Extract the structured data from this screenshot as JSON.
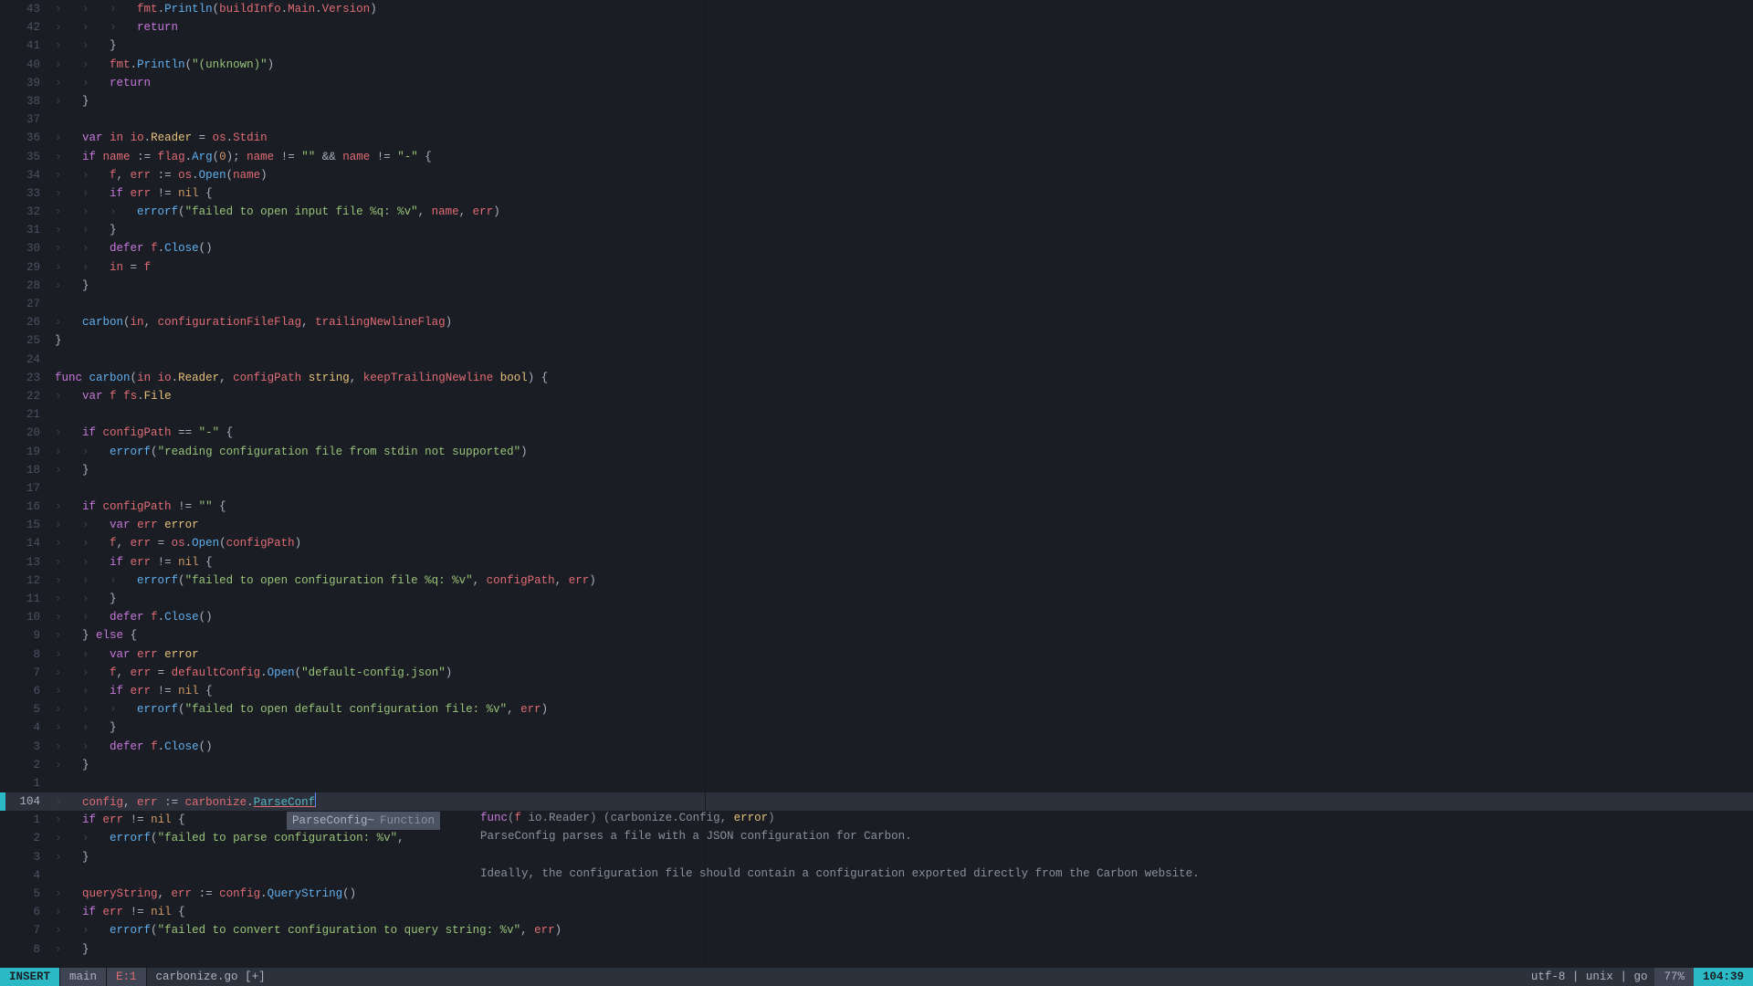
{
  "statusline": {
    "mode": "INSERT",
    "branch": "main",
    "errors": "E:1",
    "file": "carbonize.go [+]",
    "encoding": "utf-8",
    "format": "unix",
    "filetype": "go",
    "percent": "77%",
    "position": "104:39"
  },
  "completion": {
    "match": "ParseConfig~",
    "kind": "Function",
    "signature": "func(f io.Reader) (carbonize.Config, error)",
    "doc": "ParseConfig parses a file with a JSON configuration for Carbon.",
    "doc2": "Ideally, the configuration file should contain a configuration exported directly from the Carbon website."
  },
  "gutter_current": "104",
  "tabchar": "›   ",
  "code_lines": [
    {
      "rel": "43",
      "tabs": 3,
      "tokens": [
        [
          "ident",
          "fmt"
        ],
        [
          "punct",
          "."
        ],
        [
          "fnname",
          "Println"
        ],
        [
          "punct",
          "("
        ],
        [
          "ident",
          "buildInfo"
        ],
        [
          "punct",
          "."
        ],
        [
          "ident",
          "Main"
        ],
        [
          "punct",
          "."
        ],
        [
          "ident",
          "Version"
        ],
        [
          "punct",
          ")"
        ]
      ]
    },
    {
      "rel": "42",
      "tabs": 3,
      "tokens": [
        [
          "kw",
          "return"
        ]
      ]
    },
    {
      "rel": "41",
      "tabs": 2,
      "tokens": [
        [
          "punct",
          "}"
        ]
      ]
    },
    {
      "rel": "40",
      "tabs": 2,
      "tokens": [
        [
          "ident",
          "fmt"
        ],
        [
          "punct",
          "."
        ],
        [
          "fnname",
          "Println"
        ],
        [
          "punct",
          "("
        ],
        [
          "str",
          "\"(unknown)\""
        ],
        [
          "punct",
          ")"
        ]
      ]
    },
    {
      "rel": "39",
      "tabs": 2,
      "tokens": [
        [
          "kw",
          "return"
        ]
      ]
    },
    {
      "rel": "38",
      "tabs": 1,
      "tokens": [
        [
          "punct",
          "}"
        ]
      ]
    },
    {
      "rel": "37",
      "tabs": 0,
      "tokens": []
    },
    {
      "rel": "36",
      "tabs": 1,
      "tokens": [
        [
          "kw",
          "var"
        ],
        [
          "op",
          " "
        ],
        [
          "ident",
          "in"
        ],
        [
          "op",
          " "
        ],
        [
          "ident",
          "io"
        ],
        [
          "punct",
          "."
        ],
        [
          "type",
          "Reader"
        ],
        [
          "op",
          " = "
        ],
        [
          "ident",
          "os"
        ],
        [
          "punct",
          "."
        ],
        [
          "ident",
          "Stdin"
        ]
      ]
    },
    {
      "rel": "35",
      "tabs": 1,
      "tokens": [
        [
          "kw",
          "if"
        ],
        [
          "op",
          " "
        ],
        [
          "ident",
          "name"
        ],
        [
          "op",
          " := "
        ],
        [
          "ident",
          "flag"
        ],
        [
          "punct",
          "."
        ],
        [
          "fnname",
          "Arg"
        ],
        [
          "punct",
          "("
        ],
        [
          "num",
          "0"
        ],
        [
          "punct",
          "); "
        ],
        [
          "ident",
          "name"
        ],
        [
          "op",
          " != "
        ],
        [
          "str",
          "\"\""
        ],
        [
          "op",
          " && "
        ],
        [
          "ident",
          "name"
        ],
        [
          "op",
          " != "
        ],
        [
          "str",
          "\"-\""
        ],
        [
          "op",
          " "
        ],
        [
          "punct",
          "{"
        ]
      ]
    },
    {
      "rel": "34",
      "tabs": 2,
      "tokens": [
        [
          "ident",
          "f"
        ],
        [
          "punct",
          ", "
        ],
        [
          "ident",
          "err"
        ],
        [
          "op",
          " := "
        ],
        [
          "ident",
          "os"
        ],
        [
          "punct",
          "."
        ],
        [
          "fnname",
          "Open"
        ],
        [
          "punct",
          "("
        ],
        [
          "ident",
          "name"
        ],
        [
          "punct",
          ")"
        ]
      ]
    },
    {
      "rel": "33",
      "tabs": 2,
      "tokens": [
        [
          "kw",
          "if"
        ],
        [
          "op",
          " "
        ],
        [
          "ident",
          "err"
        ],
        [
          "op",
          " != "
        ],
        [
          "builtin",
          "nil"
        ],
        [
          "op",
          " "
        ],
        [
          "punct",
          "{"
        ]
      ]
    },
    {
      "rel": "32",
      "tabs": 3,
      "tokens": [
        [
          "fnname",
          "errorf"
        ],
        [
          "punct",
          "("
        ],
        [
          "str",
          "\"failed to open input file %q: %v\""
        ],
        [
          "punct",
          ", "
        ],
        [
          "ident",
          "name"
        ],
        [
          "punct",
          ", "
        ],
        [
          "ident",
          "err"
        ],
        [
          "punct",
          ")"
        ]
      ]
    },
    {
      "rel": "31",
      "tabs": 2,
      "tokens": [
        [
          "punct",
          "}"
        ]
      ]
    },
    {
      "rel": "30",
      "tabs": 2,
      "tokens": [
        [
          "kw",
          "defer"
        ],
        [
          "op",
          " "
        ],
        [
          "ident",
          "f"
        ],
        [
          "punct",
          "."
        ],
        [
          "fnname",
          "Close"
        ],
        [
          "punct",
          "()"
        ]
      ]
    },
    {
      "rel": "29",
      "tabs": 2,
      "tokens": [
        [
          "ident",
          "in"
        ],
        [
          "op",
          " = "
        ],
        [
          "ident",
          "f"
        ]
      ]
    },
    {
      "rel": "28",
      "tabs": 1,
      "tokens": [
        [
          "punct",
          "}"
        ]
      ]
    },
    {
      "rel": "27",
      "tabs": 0,
      "tokens": []
    },
    {
      "rel": "26",
      "tabs": 1,
      "tokens": [
        [
          "fnname",
          "carbon"
        ],
        [
          "punct",
          "("
        ],
        [
          "ident",
          "in"
        ],
        [
          "punct",
          ", "
        ],
        [
          "ident",
          "configurationFileFlag"
        ],
        [
          "punct",
          ", "
        ],
        [
          "ident",
          "trailingNewlineFlag"
        ],
        [
          "punct",
          ")"
        ]
      ]
    },
    {
      "rel": "25",
      "tabs": 0,
      "tokens": [
        [
          "punct",
          "}"
        ]
      ]
    },
    {
      "rel": "24",
      "tabs": 0,
      "tokens": []
    },
    {
      "rel": "23",
      "tabs": 0,
      "tokens": [
        [
          "kw",
          "func"
        ],
        [
          "op",
          " "
        ],
        [
          "fnname",
          "carbon"
        ],
        [
          "punct",
          "("
        ],
        [
          "ident",
          "in"
        ],
        [
          "op",
          " "
        ],
        [
          "ident",
          "io"
        ],
        [
          "punct",
          "."
        ],
        [
          "type",
          "Reader"
        ],
        [
          "punct",
          ", "
        ],
        [
          "ident",
          "configPath"
        ],
        [
          "op",
          " "
        ],
        [
          "type",
          "string"
        ],
        [
          "punct",
          ", "
        ],
        [
          "ident",
          "keepTrailingNewline"
        ],
        [
          "op",
          " "
        ],
        [
          "type",
          "bool"
        ],
        [
          "punct",
          ") "
        ],
        [
          "punct",
          "{"
        ]
      ]
    },
    {
      "rel": "22",
      "tabs": 1,
      "tokens": [
        [
          "kw",
          "var"
        ],
        [
          "op",
          " "
        ],
        [
          "ident",
          "f"
        ],
        [
          "op",
          " "
        ],
        [
          "ident",
          "fs"
        ],
        [
          "punct",
          "."
        ],
        [
          "type",
          "File"
        ]
      ]
    },
    {
      "rel": "21",
      "tabs": 0,
      "tokens": []
    },
    {
      "rel": "20",
      "tabs": 1,
      "tokens": [
        [
          "kw",
          "if"
        ],
        [
          "op",
          " "
        ],
        [
          "ident",
          "configPath"
        ],
        [
          "op",
          " == "
        ],
        [
          "str",
          "\"-\""
        ],
        [
          "op",
          " "
        ],
        [
          "punct",
          "{"
        ]
      ]
    },
    {
      "rel": "19",
      "tabs": 2,
      "tokens": [
        [
          "fnname",
          "errorf"
        ],
        [
          "punct",
          "("
        ],
        [
          "str",
          "\"reading configuration file from stdin not supported\""
        ],
        [
          "punct",
          ")"
        ]
      ]
    },
    {
      "rel": "18",
      "tabs": 1,
      "tokens": [
        [
          "punct",
          "}"
        ]
      ]
    },
    {
      "rel": "17",
      "tabs": 0,
      "tokens": []
    },
    {
      "rel": "16",
      "tabs": 1,
      "tokens": [
        [
          "kw",
          "if"
        ],
        [
          "op",
          " "
        ],
        [
          "ident",
          "configPath"
        ],
        [
          "op",
          " != "
        ],
        [
          "str",
          "\"\""
        ],
        [
          "op",
          " "
        ],
        [
          "punct",
          "{"
        ]
      ]
    },
    {
      "rel": "15",
      "tabs": 2,
      "tokens": [
        [
          "kw",
          "var"
        ],
        [
          "op",
          " "
        ],
        [
          "ident",
          "err"
        ],
        [
          "op",
          " "
        ],
        [
          "type",
          "error"
        ]
      ]
    },
    {
      "rel": "14",
      "tabs": 2,
      "tokens": [
        [
          "ident",
          "f"
        ],
        [
          "punct",
          ", "
        ],
        [
          "ident",
          "err"
        ],
        [
          "op",
          " = "
        ],
        [
          "ident",
          "os"
        ],
        [
          "punct",
          "."
        ],
        [
          "fnname",
          "Open"
        ],
        [
          "punct",
          "("
        ],
        [
          "ident",
          "configPath"
        ],
        [
          "punct",
          ")"
        ]
      ]
    },
    {
      "rel": "13",
      "tabs": 2,
      "tokens": [
        [
          "kw",
          "if"
        ],
        [
          "op",
          " "
        ],
        [
          "ident",
          "err"
        ],
        [
          "op",
          " != "
        ],
        [
          "builtin",
          "nil"
        ],
        [
          "op",
          " "
        ],
        [
          "punct",
          "{"
        ]
      ]
    },
    {
      "rel": "12",
      "tabs": 3,
      "tokens": [
        [
          "fnname",
          "errorf"
        ],
        [
          "punct",
          "("
        ],
        [
          "str",
          "\"failed to open configuration file %q: %v\""
        ],
        [
          "punct",
          ", "
        ],
        [
          "ident",
          "configPath"
        ],
        [
          "punct",
          ", "
        ],
        [
          "ident",
          "err"
        ],
        [
          "punct",
          ")"
        ]
      ]
    },
    {
      "rel": "11",
      "tabs": 2,
      "tokens": [
        [
          "punct",
          "}"
        ]
      ]
    },
    {
      "rel": "10",
      "tabs": 2,
      "tokens": [
        [
          "kw",
          "defer"
        ],
        [
          "op",
          " "
        ],
        [
          "ident",
          "f"
        ],
        [
          "punct",
          "."
        ],
        [
          "fnname",
          "Close"
        ],
        [
          "punct",
          "()"
        ]
      ]
    },
    {
      "rel": "9",
      "tabs": 1,
      "tokens": [
        [
          "punct",
          "} "
        ],
        [
          "kw",
          "else"
        ],
        [
          "op",
          " "
        ],
        [
          "punct",
          "{"
        ]
      ]
    },
    {
      "rel": "8",
      "tabs": 2,
      "tokens": [
        [
          "kw",
          "var"
        ],
        [
          "op",
          " "
        ],
        [
          "ident",
          "err"
        ],
        [
          "op",
          " "
        ],
        [
          "type",
          "error"
        ]
      ]
    },
    {
      "rel": "7",
      "tabs": 2,
      "tokens": [
        [
          "ident",
          "f"
        ],
        [
          "punct",
          ", "
        ],
        [
          "ident",
          "err"
        ],
        [
          "op",
          " = "
        ],
        [
          "ident",
          "defaultConfig"
        ],
        [
          "punct",
          "."
        ],
        [
          "fnname",
          "Open"
        ],
        [
          "punct",
          "("
        ],
        [
          "str",
          "\"default-config.json\""
        ],
        [
          "punct",
          ")"
        ]
      ]
    },
    {
      "rel": "6",
      "tabs": 2,
      "tokens": [
        [
          "kw",
          "if"
        ],
        [
          "op",
          " "
        ],
        [
          "ident",
          "err"
        ],
        [
          "op",
          " != "
        ],
        [
          "builtin",
          "nil"
        ],
        [
          "op",
          " "
        ],
        [
          "punct",
          "{"
        ]
      ]
    },
    {
      "rel": "5",
      "tabs": 3,
      "tokens": [
        [
          "fnname",
          "errorf"
        ],
        [
          "punct",
          "("
        ],
        [
          "str",
          "\"failed to open default configuration file: %v\""
        ],
        [
          "punct",
          ", "
        ],
        [
          "ident",
          "err"
        ],
        [
          "punct",
          ")"
        ]
      ]
    },
    {
      "rel": "4",
      "tabs": 2,
      "tokens": [
        [
          "punct",
          "}"
        ]
      ]
    },
    {
      "rel": "3",
      "tabs": 2,
      "tokens": [
        [
          "kw",
          "defer"
        ],
        [
          "op",
          " "
        ],
        [
          "ident",
          "f"
        ],
        [
          "punct",
          "."
        ],
        [
          "fnname",
          "Close"
        ],
        [
          "punct",
          "()"
        ]
      ]
    },
    {
      "rel": "2",
      "tabs": 1,
      "tokens": [
        [
          "punct",
          "}"
        ]
      ]
    },
    {
      "rel": "1",
      "tabs": 0,
      "tokens": []
    },
    {
      "rel": "104",
      "current": true,
      "tabs": 1,
      "tokens": [
        [
          "ident",
          "config"
        ],
        [
          "punct",
          ", "
        ],
        [
          "ident",
          "err"
        ],
        [
          "op",
          " := "
        ],
        [
          "ident",
          "carbonize"
        ],
        [
          "punct",
          "."
        ],
        [
          "underline",
          "ParseConf"
        ],
        [
          "cursor",
          ""
        ]
      ]
    },
    {
      "rel": "1",
      "tabs": 1,
      "tokens": [
        [
          "kw",
          "if"
        ],
        [
          "op",
          " "
        ],
        [
          "ident",
          "err"
        ],
        [
          "op",
          " != "
        ],
        [
          "builtin",
          "nil"
        ],
        [
          "op",
          " "
        ],
        [
          "punct",
          "{"
        ]
      ]
    },
    {
      "rel": "2",
      "tabs": 2,
      "tokens": [
        [
          "fnname",
          "errorf"
        ],
        [
          "punct",
          "("
        ],
        [
          "str",
          "\"failed to parse configuration: %v\""
        ],
        [
          "punct",
          ","
        ]
      ]
    },
    {
      "rel": "3",
      "tabs": 1,
      "tokens": [
        [
          "punct",
          "}"
        ]
      ]
    },
    {
      "rel": "4",
      "tabs": 0,
      "tokens": []
    },
    {
      "rel": "5",
      "tabs": 1,
      "tokens": [
        [
          "ident",
          "queryString"
        ],
        [
          "punct",
          ", "
        ],
        [
          "ident",
          "err"
        ],
        [
          "op",
          " := "
        ],
        [
          "ident",
          "config"
        ],
        [
          "punct",
          "."
        ],
        [
          "fnname",
          "QueryString"
        ],
        [
          "punct",
          "()"
        ]
      ]
    },
    {
      "rel": "6",
      "tabs": 1,
      "tokens": [
        [
          "kw",
          "if"
        ],
        [
          "op",
          " "
        ],
        [
          "ident",
          "err"
        ],
        [
          "op",
          " != "
        ],
        [
          "builtin",
          "nil"
        ],
        [
          "op",
          " "
        ],
        [
          "punct",
          "{"
        ]
      ]
    },
    {
      "rel": "7",
      "tabs": 2,
      "tokens": [
        [
          "fnname",
          "errorf"
        ],
        [
          "punct",
          "("
        ],
        [
          "str",
          "\"failed to convert configuration to query string: %v\""
        ],
        [
          "punct",
          ", "
        ],
        [
          "ident",
          "err"
        ],
        [
          "punct",
          ")"
        ]
      ]
    },
    {
      "rel": "8",
      "tabs": 1,
      "tokens": [
        [
          "punct",
          "}"
        ]
      ]
    }
  ]
}
